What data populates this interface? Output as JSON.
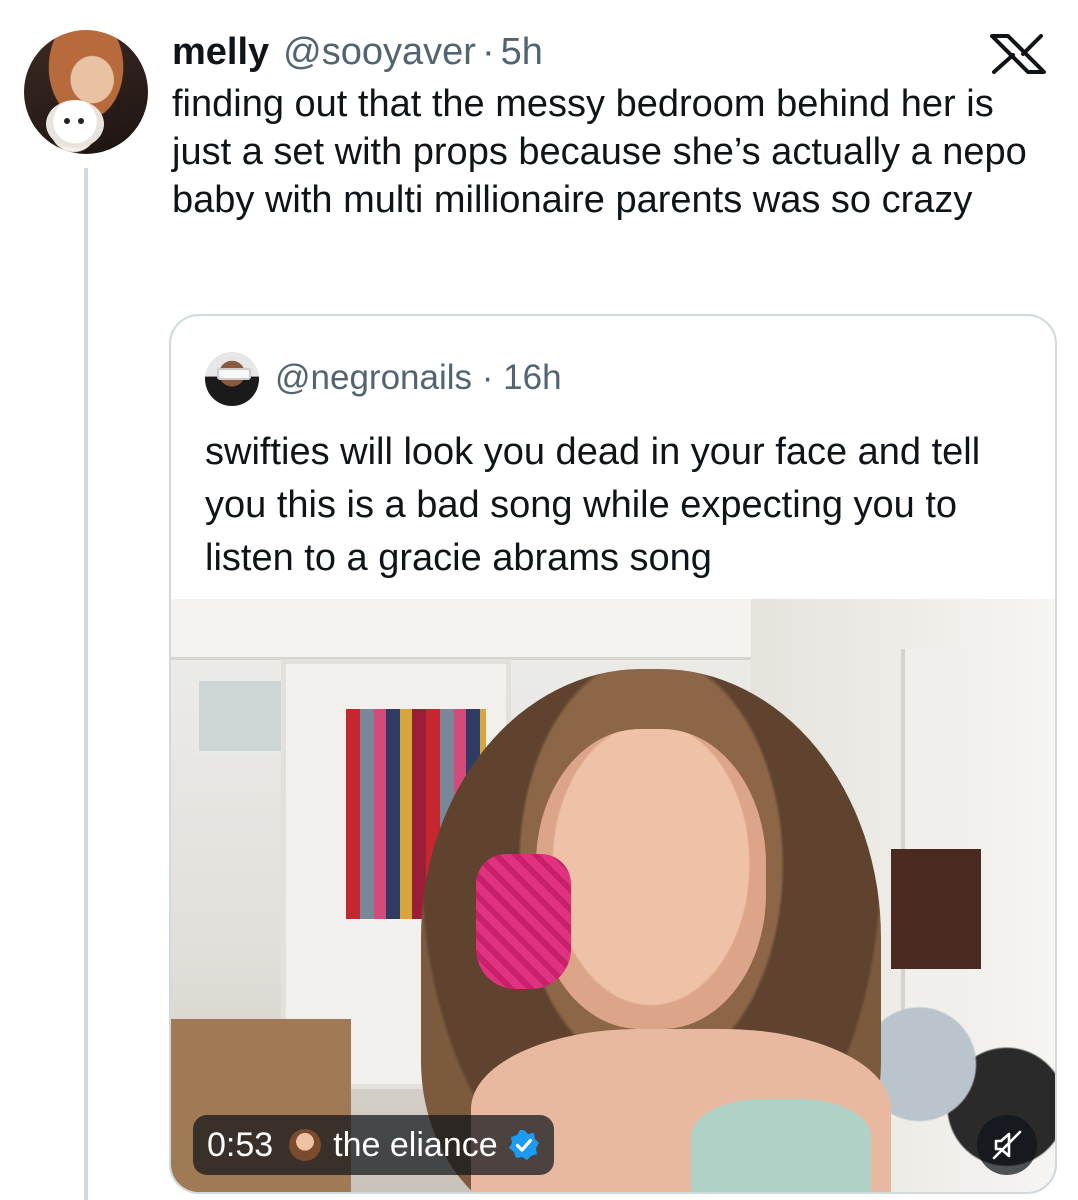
{
  "tweet": {
    "display_name": "melly",
    "handle": "@sooyaver",
    "separator": "·",
    "time": "5h",
    "text": "finding out that the messy bedroom behind her is just a set with props because she’s actually a nepo baby with multi millionaire parents was so crazy"
  },
  "quoted_tweet": {
    "handle": "@negronails",
    "separator": "·",
    "time": "16h",
    "text": "swifties will look you dead in your face and tell you this is a bad song while expecting you to listen to a gracie abrams song"
  },
  "video": {
    "duration": "0:53",
    "attribution": "the eliance"
  },
  "icons": {
    "brand": "x-logo-icon",
    "verified": "verified-badge-icon",
    "mute": "muted-speaker-icon"
  },
  "colors": {
    "text_primary": "#0f1419",
    "text_secondary": "#536471",
    "border": "#cfd9de",
    "verified_blue": "#1d9bf0"
  }
}
